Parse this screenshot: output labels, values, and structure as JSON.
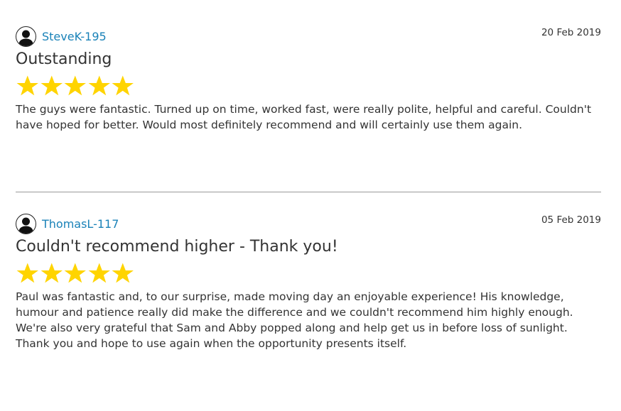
{
  "reviews": [
    {
      "author": "SteveK-195",
      "date": "20 Feb 2019",
      "title": "Outstanding",
      "rating": 5,
      "rating_max": 5,
      "body": [
        "The guys were fantastic. Turned up on time, worked fast, were really polite, helpful and careful. Couldn't have hoped for better. Would most definitely recommend and will certainly use them again."
      ]
    },
    {
      "author": "ThomasL-117",
      "date": "05 Feb 2019",
      "title": "Couldn't recommend higher - Thank you!",
      "rating": 5,
      "rating_max": 5,
      "body": [
        "Paul was fantastic and, to our surprise, made moving day an enjoyable experience! His knowledge, humour and patience really did make the difference and we couldn't recommend him highly enough.",
        "We're also very grateful that Sam and Abby popped along and help get us in before loss of sunlight. Thank you and hope to use again when the opportunity presents itself."
      ]
    }
  ],
  "colors": {
    "author_link": "#1a82b8",
    "star": "#ffd400",
    "text": "#333333",
    "divider": "#999999"
  },
  "icons": {
    "avatar": "user-silhouette-icon",
    "star": "star-icon"
  }
}
